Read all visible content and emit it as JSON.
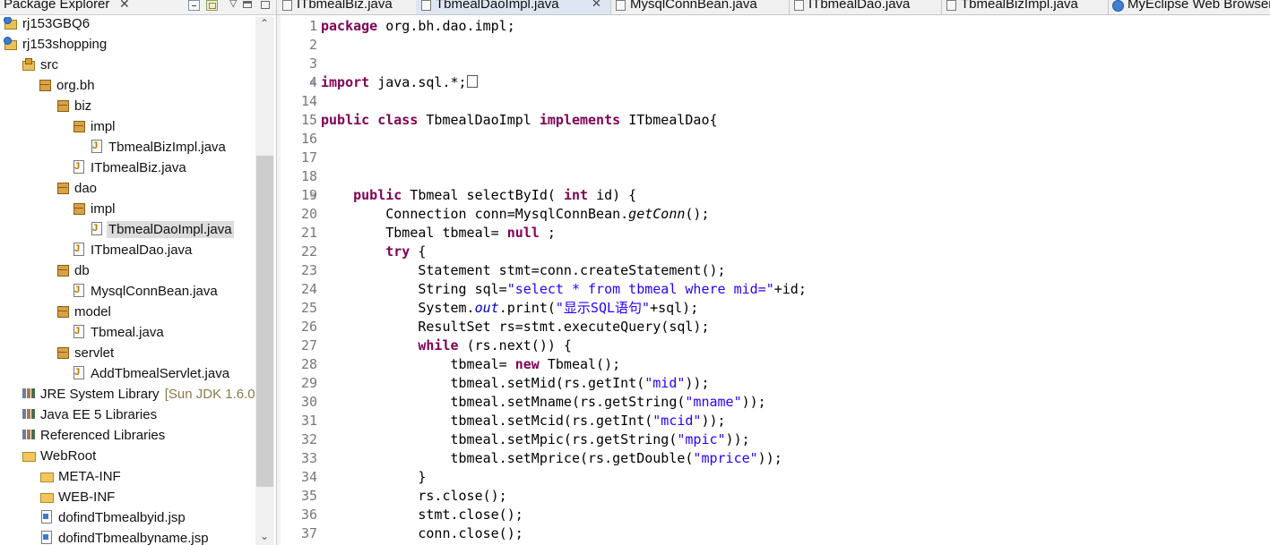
{
  "explorer": {
    "title": "Package Explorer",
    "close_glyph": "✕",
    "view_menu_glyph": "▽",
    "tree": [
      {
        "label": "rj153GBQ6",
        "icon": "project-icon",
        "decoration": ""
      },
      {
        "label": "rj153shopping",
        "icon": "project-icon",
        "decoration": ""
      },
      {
        "label": "src",
        "icon": "source-folder-icon",
        "decoration": ""
      },
      {
        "label": "org.bh",
        "icon": "package-icon",
        "decoration": ""
      },
      {
        "label": "biz",
        "icon": "package-icon",
        "decoration": ""
      },
      {
        "label": "impl",
        "icon": "package-icon",
        "decoration": ""
      },
      {
        "label": "TbmealBizImpl.java",
        "icon": "java-file-icon",
        "decoration": ""
      },
      {
        "label": "ITbmealBiz.java",
        "icon": "java-file-icon",
        "decoration": ""
      },
      {
        "label": "dao",
        "icon": "package-icon",
        "decoration": ""
      },
      {
        "label": "impl",
        "icon": "package-icon",
        "decoration": ""
      },
      {
        "label": "TbmealDaoImpl.java",
        "icon": "java-file-icon",
        "decoration": ""
      },
      {
        "label": "ITbmealDao.java",
        "icon": "java-file-icon",
        "decoration": ""
      },
      {
        "label": "db",
        "icon": "package-icon",
        "decoration": ""
      },
      {
        "label": "MysqlConnBean.java",
        "icon": "java-file-icon",
        "decoration": ""
      },
      {
        "label": "model",
        "icon": "package-icon",
        "decoration": ""
      },
      {
        "label": "Tbmeal.java",
        "icon": "java-file-icon",
        "decoration": ""
      },
      {
        "label": "servlet",
        "icon": "package-icon",
        "decoration": ""
      },
      {
        "label": "AddTbmealServlet.java",
        "icon": "java-file-icon",
        "decoration": ""
      },
      {
        "label": "JRE System Library",
        "icon": "library-icon",
        "decoration": "[Sun JDK 1.6.0"
      },
      {
        "label": "Java EE 5 Libraries",
        "icon": "library-icon",
        "decoration": ""
      },
      {
        "label": "Referenced Libraries",
        "icon": "library-icon",
        "decoration": ""
      },
      {
        "label": "WebRoot",
        "icon": "folder-icon",
        "decoration": ""
      },
      {
        "label": "META-INF",
        "icon": "folder-icon",
        "decoration": ""
      },
      {
        "label": "WEB-INF",
        "icon": "folder-icon",
        "decoration": ""
      },
      {
        "label": "dofindTbmealbyid.jsp",
        "icon": "jsp-file-icon",
        "decoration": ""
      },
      {
        "label": "dofindTbmealbyname.jsp",
        "icon": "jsp-file-icon",
        "decoration": ""
      }
    ],
    "selected_index": 10
  },
  "tabs": [
    {
      "label": "ITbmealBiz.java",
      "active": false
    },
    {
      "label": "TbmealDaoImpl.java",
      "active": true
    },
    {
      "label": "MysqlConnBean.java",
      "active": false
    },
    {
      "label": "ITbmealDao.java",
      "active": false
    },
    {
      "label": "TbmealBizImpl.java",
      "active": false
    },
    {
      "label": "MyEclipse Web Browser",
      "active": false
    }
  ],
  "editor": {
    "lines": [
      {
        "n": "1",
        "fold": "",
        "tokens": [
          [
            "kw",
            "package"
          ],
          [
            "",
            "org.bh.dao.impl;"
          ]
        ]
      },
      {
        "n": "2",
        "fold": "",
        "tokens": []
      },
      {
        "n": "3",
        "fold": "",
        "tokens": []
      },
      {
        "n": "4",
        "fold": "⊕",
        "tokens": [
          [
            "kw",
            "import"
          ],
          [
            "",
            "java.sql.*;"
          ],
          [
            "box",
            ""
          ]
        ]
      },
      {
        "n": "14",
        "fold": "",
        "tokens": []
      },
      {
        "n": "15",
        "fold": "",
        "tokens": [
          [
            "kw",
            "public"
          ],
          [
            "",
            ""
          ],
          [
            "kw",
            "class"
          ],
          [
            "",
            "TbmealDaoImpl"
          ],
          [
            "kw",
            "implements"
          ],
          [
            "",
            "ITbmealDao{"
          ]
        ]
      },
      {
        "n": "16",
        "fold": "",
        "tokens": []
      },
      {
        "n": "17",
        "fold": "",
        "tokens": []
      },
      {
        "n": "18",
        "fold": "",
        "tokens": []
      },
      {
        "n": "19",
        "fold": "⊖",
        "tokens": [
          [
            "",
            "    "
          ],
          [
            "kw",
            "public"
          ],
          [
            "",
            "Tbmeal selectById("
          ],
          [
            "kw",
            "int"
          ],
          [
            "",
            "id) {"
          ]
        ]
      },
      {
        "n": "20",
        "fold": "",
        "tokens": [
          [
            "",
            "        Connection conn=MysqlConnBean."
          ],
          [
            "it",
            "getConn"
          ],
          [
            "",
            "();"
          ]
        ]
      },
      {
        "n": "21",
        "fold": "",
        "tokens": [
          [
            "",
            "        Tbmeal tbmeal="
          ],
          [
            "kw",
            "null"
          ],
          [
            "",
            ";"
          ]
        ]
      },
      {
        "n": "22",
        "fold": "",
        "tokens": [
          [
            "",
            "        "
          ],
          [
            "kw",
            "try"
          ],
          [
            "",
            "{"
          ]
        ]
      },
      {
        "n": "23",
        "fold": "",
        "tokens": [
          [
            "",
            "            Statement stmt=conn.createStatement();"
          ]
        ]
      },
      {
        "n": "24",
        "fold": "",
        "tokens": [
          [
            "",
            "            String sql="
          ],
          [
            "str",
            "\"select * from tbmeal where mid=\""
          ],
          [
            "",
            "+id;"
          ]
        ]
      },
      {
        "n": "25",
        "fold": "",
        "tokens": [
          [
            "",
            "            System."
          ],
          [
            "fld",
            "out"
          ],
          [
            "",
            ".print("
          ],
          [
            "str",
            "\"显示SQL语句\""
          ],
          [
            "",
            "+sql);"
          ]
        ]
      },
      {
        "n": "26",
        "fold": "",
        "tokens": [
          [
            "",
            "            ResultSet rs=stmt.executeQuery(sql);"
          ]
        ]
      },
      {
        "n": "27",
        "fold": "",
        "tokens": [
          [
            "",
            "            "
          ],
          [
            "kw",
            "while"
          ],
          [
            "",
            "(rs.next()) {"
          ]
        ]
      },
      {
        "n": "28",
        "fold": "",
        "tokens": [
          [
            "",
            "                tbmeal="
          ],
          [
            "kw",
            "new"
          ],
          [
            "",
            "Tbmeal();"
          ]
        ]
      },
      {
        "n": "29",
        "fold": "",
        "tokens": [
          [
            "",
            "                tbmeal.setMid(rs.getInt("
          ],
          [
            "str",
            "\"mid\""
          ],
          [
            "",
            "));"
          ]
        ]
      },
      {
        "n": "30",
        "fold": "",
        "tokens": [
          [
            "",
            "                tbmeal.setMname(rs.getString("
          ],
          [
            "str",
            "\"mname\""
          ],
          [
            "",
            "));"
          ]
        ]
      },
      {
        "n": "31",
        "fold": "",
        "tokens": [
          [
            "",
            "                tbmeal.setMcid(rs.getInt("
          ],
          [
            "str",
            "\"mcid\""
          ],
          [
            "",
            "));"
          ]
        ]
      },
      {
        "n": "32",
        "fold": "",
        "tokens": [
          [
            "",
            "                tbmeal.setMpic(rs.getString("
          ],
          [
            "str",
            "\"mpic\""
          ],
          [
            "",
            "));"
          ]
        ]
      },
      {
        "n": "33",
        "fold": "",
        "tokens": [
          [
            "",
            "                tbmeal.setMprice(rs.getDouble("
          ],
          [
            "str",
            "\"mprice\""
          ],
          [
            "",
            "));"
          ]
        ]
      },
      {
        "n": "34",
        "fold": "",
        "tokens": [
          [
            "",
            "            }"
          ]
        ]
      },
      {
        "n": "35",
        "fold": "",
        "tokens": [
          [
            "",
            "            rs.close();"
          ]
        ]
      },
      {
        "n": "36",
        "fold": "",
        "tokens": [
          [
            "",
            "            stmt.close();"
          ]
        ]
      },
      {
        "n": "37",
        "fold": "",
        "tokens": [
          [
            "",
            "            conn.close();"
          ]
        ]
      }
    ]
  },
  "colors": {
    "keyword": "#7f0055",
    "string": "#2a00ff",
    "field": "#0000c0",
    "line_number": "#787878",
    "selection": "#dcdcdc"
  }
}
